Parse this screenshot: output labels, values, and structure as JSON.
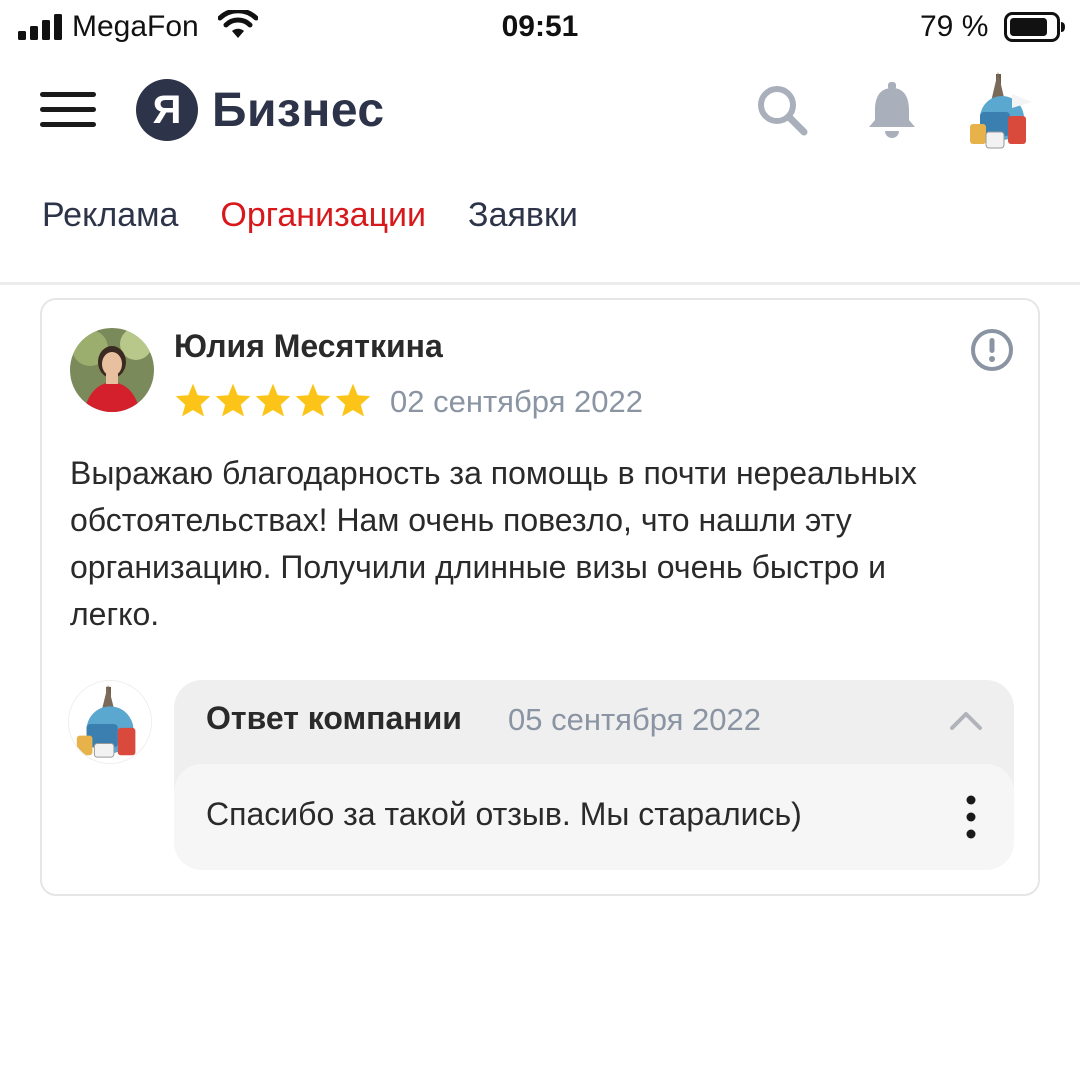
{
  "status_bar": {
    "carrier": "MegaFon",
    "time": "09:51",
    "battery_percent": "79 %",
    "icons": [
      "signal-icon",
      "wifi-icon",
      "battery-icon"
    ]
  },
  "header": {
    "logo_letter": "Я",
    "logo_text": "Бизнес",
    "icons": [
      "menu-icon",
      "search-icon",
      "bell-icon",
      "avatar"
    ],
    "colors": {
      "brand": "#2d3348",
      "icon_gray": "#a9b0bb"
    }
  },
  "tabs": [
    {
      "label": "Реклама",
      "active": false
    },
    {
      "label": "Организации",
      "active": true
    },
    {
      "label": "Заявки",
      "active": false
    }
  ],
  "review": {
    "author": "Юлия Месяткина",
    "rating": 5,
    "rating_max": 5,
    "date": "02 сентября 2022",
    "text": "Выражаю благодарность за помощь в почти нереальных обстоятельствах! Нам очень повезло, что нашли эту организацию. Получили длинные визы очень быстро и легко.",
    "colors": {
      "star": "#fcc419",
      "date": "#8a94a3",
      "active_tab": "#d8191c"
    }
  },
  "reply": {
    "title": "Ответ компании",
    "date": "05 сентября 2022",
    "text": "Спасибо за такой отзыв. Мы старались)"
  }
}
